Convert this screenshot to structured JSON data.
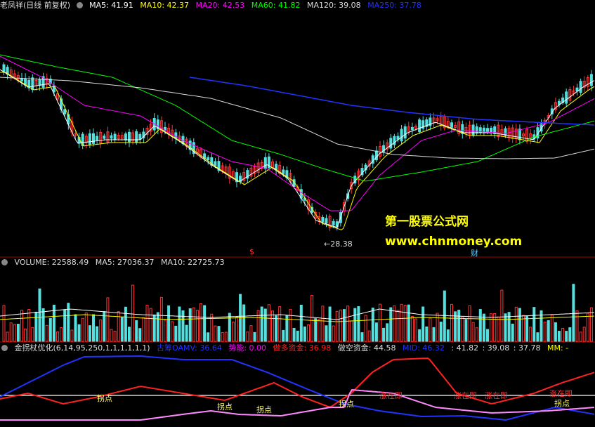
{
  "price_panel": {
    "stock_title": "老凤祥(日线 前复权)",
    "ma_labels": [
      {
        "text": "MA5: 41.91",
        "color": "#ffffff"
      },
      {
        "text": "MA10: 42.37",
        "color": "#ffff00"
      },
      {
        "text": "MA20: 42.53",
        "color": "#ff00ff"
      },
      {
        "text": "MA60: 41.82",
        "color": "#00ff00"
      },
      {
        "text": "MA120: 39.08",
        "color": "#dddddd"
      },
      {
        "text": "MA250: 37.78",
        "color": "#2233ff"
      }
    ],
    "low_label": "28.38",
    "marker_left": "$",
    "marker_right": "财"
  },
  "watermark": {
    "line1": "第一股票公式网",
    "line2": "www.chnmoney.com"
  },
  "volume_panel": {
    "labels": [
      {
        "text": "VOLUME: 22588.49",
        "color": "#dddddd"
      },
      {
        "text": "MA5: 27036.37",
        "color": "#dddddd"
      },
      {
        "text": "MA10: 22725.73",
        "color": "#dddddd"
      }
    ]
  },
  "indicator_panel": {
    "labels": [
      {
        "text": "金拐杖优化(6,14,95,250,1,1,1,1,1,1)",
        "color": "#dddddd"
      },
      {
        "text": "古筹OAMV: 36.64",
        "color": "#2233ff"
      },
      {
        "text": "势能: 0.00",
        "color": "#ff00ff"
      },
      {
        "text": "做多资金: 36.98",
        "color": "#ff2222"
      },
      {
        "text": "做空资金: 44.58",
        "color": "#dddddd"
      },
      {
        "text": "MID: 46.32",
        "color": "#2233ff"
      },
      {
        "text": ": 41.82",
        "color": "#dddddd"
      },
      {
        "text": ": 39.08",
        "color": "#dddddd"
      },
      {
        "text": ": 37.78",
        "color": "#dddddd"
      },
      {
        "text": "MM: -",
        "color": "#ffff00"
      }
    ],
    "annotations": [
      {
        "text": "拐点",
        "color": "#ffff66"
      },
      {
        "text": "拐点",
        "color": "#ffff66"
      },
      {
        "text": "拐点",
        "color": "#ffff66"
      },
      {
        "text": "拐点",
        "color": "#ffff66"
      },
      {
        "text": "拐点",
        "color": "#ffff66"
      },
      {
        "text": "涨在即",
        "color": "#ff3333"
      },
      {
        "text": "涨在即",
        "color": "#ff3333"
      },
      {
        "text": "涨在即",
        "color": "#ff3333"
      },
      {
        "text": "涨在即",
        "color": "#ff3333"
      }
    ]
  },
  "colors": {
    "up": "#ff3333",
    "down": "#55e0e0",
    "separator": "#aa0000"
  }
}
